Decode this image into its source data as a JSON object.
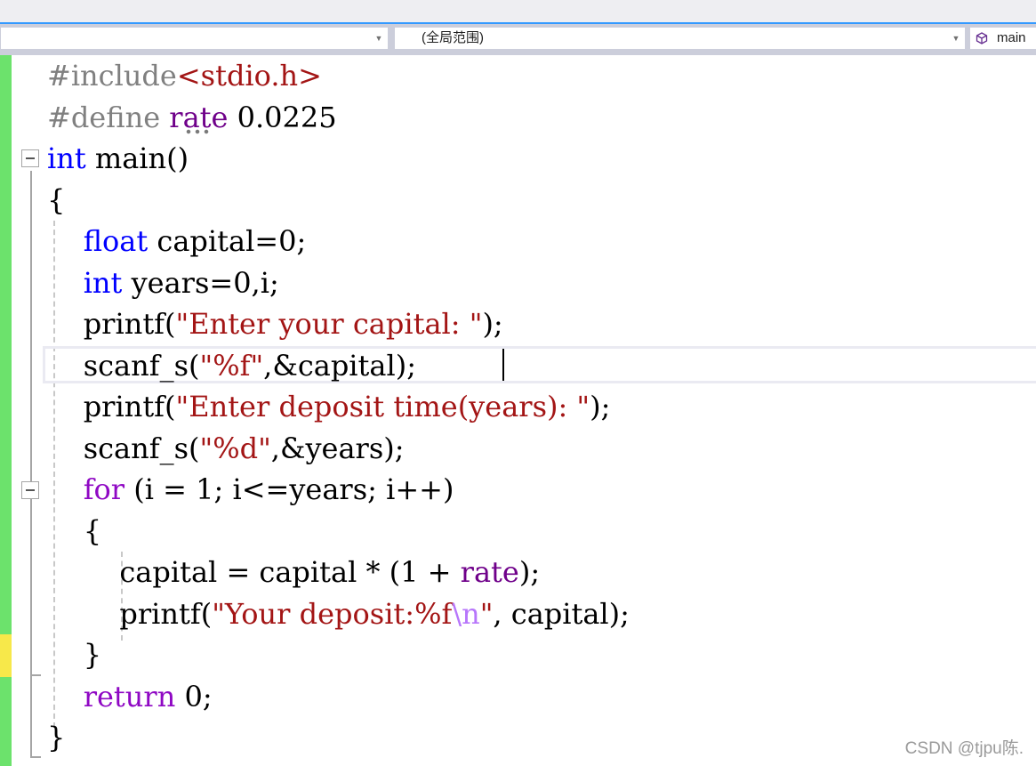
{
  "navbar": {
    "project_combo": "",
    "scope_combo": "(全局范围)",
    "member_combo": "main"
  },
  "code_lines": [
    {
      "parts": [
        [
          "#include",
          "pp"
        ],
        [
          "<stdio.h>",
          "str"
        ]
      ]
    },
    {
      "parts": [
        [
          "#define ",
          "pp"
        ],
        [
          "rate",
          "mac"
        ],
        [
          " 0.0225",
          ""
        ]
      ]
    },
    {
      "parts": [
        [
          "int",
          "kw"
        ],
        [
          " main()",
          ""
        ]
      ]
    },
    {
      "parts": [
        [
          "{",
          ""
        ]
      ]
    },
    {
      "parts": [
        [
          "    ",
          ""
        ],
        [
          "float",
          "kw"
        ],
        [
          " capital=0;",
          ""
        ]
      ]
    },
    {
      "parts": [
        [
          "    ",
          ""
        ],
        [
          "int",
          "kw"
        ],
        [
          " years=0,i;",
          ""
        ]
      ]
    },
    {
      "parts": [
        [
          "    printf(",
          ""
        ],
        [
          "\"Enter your capital: \"",
          "str"
        ],
        [
          ");",
          ""
        ]
      ]
    },
    {
      "parts": [
        [
          "    scanf_s(",
          ""
        ],
        [
          "\"%f\"",
          "str"
        ],
        [
          ",&capital);",
          ""
        ]
      ]
    },
    {
      "parts": [
        [
          "    printf(",
          ""
        ],
        [
          "\"Enter deposit time(years): \"",
          "str"
        ],
        [
          ");",
          ""
        ]
      ]
    },
    {
      "parts": [
        [
          "    scanf_s(",
          ""
        ],
        [
          "\"%d\"",
          "str"
        ],
        [
          ",&years);",
          ""
        ]
      ]
    },
    {
      "parts": [
        [
          "    ",
          ""
        ],
        [
          "for",
          "ctl"
        ],
        [
          " (i = 1; i<=years; i++)",
          ""
        ]
      ]
    },
    {
      "parts": [
        [
          "    {",
          ""
        ]
      ]
    },
    {
      "parts": [
        [
          "        capital = capital * (1 + ",
          ""
        ],
        [
          "rate",
          "mac"
        ],
        [
          ");",
          ""
        ]
      ]
    },
    {
      "parts": [
        [
          "        printf(",
          ""
        ],
        [
          "\"Your deposit:%f",
          "str"
        ],
        [
          "\\n",
          "esc"
        ],
        [
          "\"",
          "str"
        ],
        [
          ", capital);",
          ""
        ]
      ]
    },
    {
      "parts": [
        [
          "    }",
          ""
        ]
      ]
    },
    {
      "parts": [
        [
          "    ",
          ""
        ],
        [
          "return",
          "ctl"
        ],
        [
          " 0;",
          ""
        ]
      ]
    },
    {
      "parts": [
        [
          "}",
          ""
        ]
      ]
    }
  ],
  "watermark": "CSDN @tjpu陈.",
  "colors": {
    "keyword": "#0000ff",
    "control": "#8f08c4",
    "preprocessor": "#808080",
    "string": "#a31515",
    "macro": "#6f008a",
    "margin_saved": "#6ce26c",
    "margin_unsaved": "#f7e84a"
  },
  "icons": {
    "member_icon": "cube-icon",
    "dropdown": "chevron-down-icon",
    "fold": "collapse-icon"
  }
}
